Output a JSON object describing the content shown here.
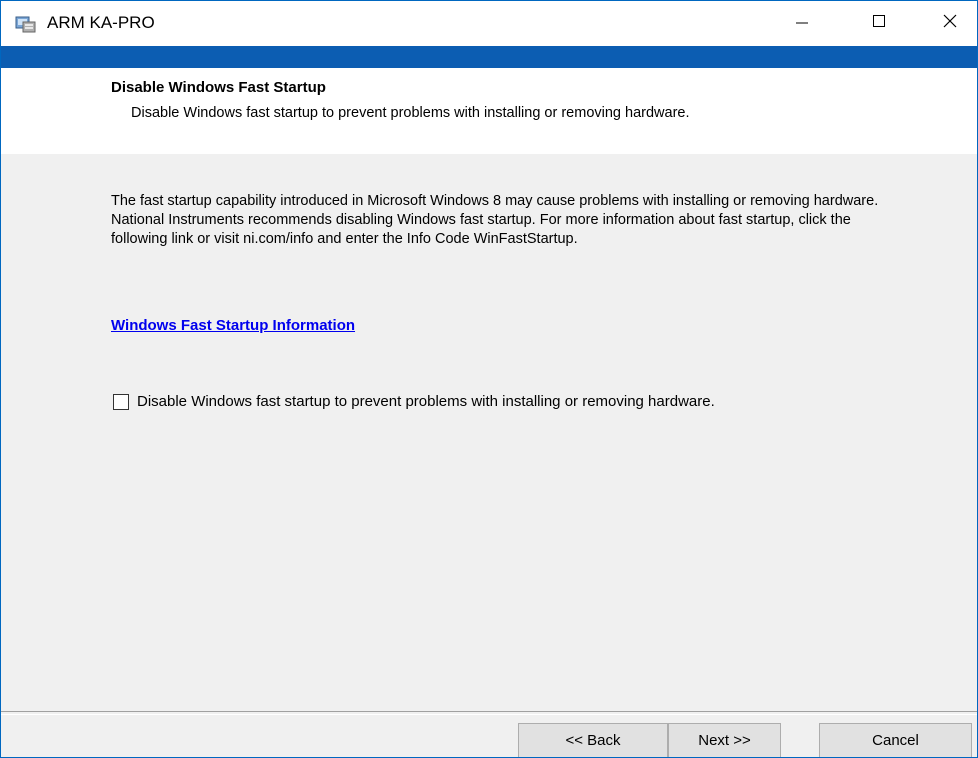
{
  "window": {
    "title": "ARM KA-PRO",
    "controls": {
      "minimize": "minimize-icon",
      "maximize": "maximize-icon",
      "close": "close-icon"
    }
  },
  "header": {
    "title": "Disable Windows Fast Startup",
    "subtitle": "Disable Windows fast startup to prevent problems with installing or removing hardware."
  },
  "body": {
    "description": "The fast startup capability introduced in Microsoft Windows 8 may cause problems with installing or removing hardware. National Instruments recommends disabling Windows fast startup. For more information about fast startup, click the following link or visit ni.com/info and enter the Info Code WinFastStartup.",
    "link_text": "Windows Fast Startup Information",
    "checkbox": {
      "label": "Disable Windows fast startup to prevent problems with installing or removing hardware.",
      "checked": false
    }
  },
  "footer": {
    "back_label": "<< Back",
    "next_label": "Next >>",
    "cancel_label": "Cancel"
  },
  "colors": {
    "accent": "#0c5db2",
    "link": "#0000ee",
    "background": "#f0f0f0"
  }
}
